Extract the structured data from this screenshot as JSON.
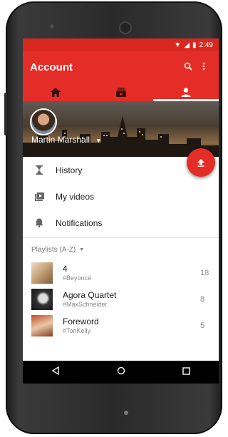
{
  "status": {
    "time": "2:49"
  },
  "appbar": {
    "title": "Account",
    "search_icon": "search-icon",
    "more_icon": "more-vert-icon"
  },
  "tabs": [
    {
      "icon": "home-icon"
    },
    {
      "icon": "subscriptions-icon"
    },
    {
      "icon": "account-icon",
      "active": true
    }
  ],
  "user": {
    "name": "Martin Marshall"
  },
  "fab": {
    "icon": "upload-icon"
  },
  "menu": [
    {
      "label": "History",
      "icon": "hourglass-icon"
    },
    {
      "label": "My videos",
      "icon": "my-videos-icon"
    },
    {
      "label": "Notifications",
      "icon": "bell-icon"
    }
  ],
  "playlists": {
    "header": "Playlists (A-Z)",
    "items": [
      {
        "name": "4",
        "sub": "#Beyoncé",
        "count": "18"
      },
      {
        "name": "Agora Quartet",
        "sub": "#MaxSchneider",
        "count": "8"
      },
      {
        "name": "Foreword",
        "sub": "#ToriKelly",
        "count": "5"
      }
    ]
  },
  "colors": {
    "brand": "#e52d27"
  }
}
